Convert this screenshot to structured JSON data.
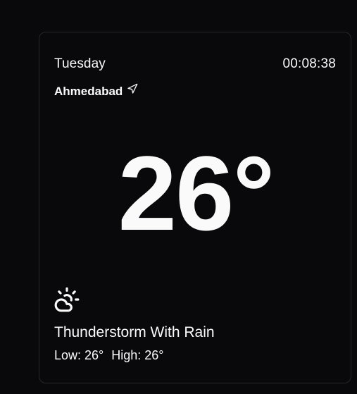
{
  "weather": {
    "day": "Tuesday",
    "clock": "00:08:38",
    "city": "Ahmedabad",
    "location_icon": "navigation-arrow-icon",
    "temperature": "26°",
    "condition_icon": "cloud-sun-icon",
    "condition": "Thunderstorm With Rain",
    "low": "Low: 26°",
    "high": "High: 26°"
  },
  "colors": {
    "background": "#09090b",
    "card_border": "#27272a",
    "text": "#fafafa"
  }
}
